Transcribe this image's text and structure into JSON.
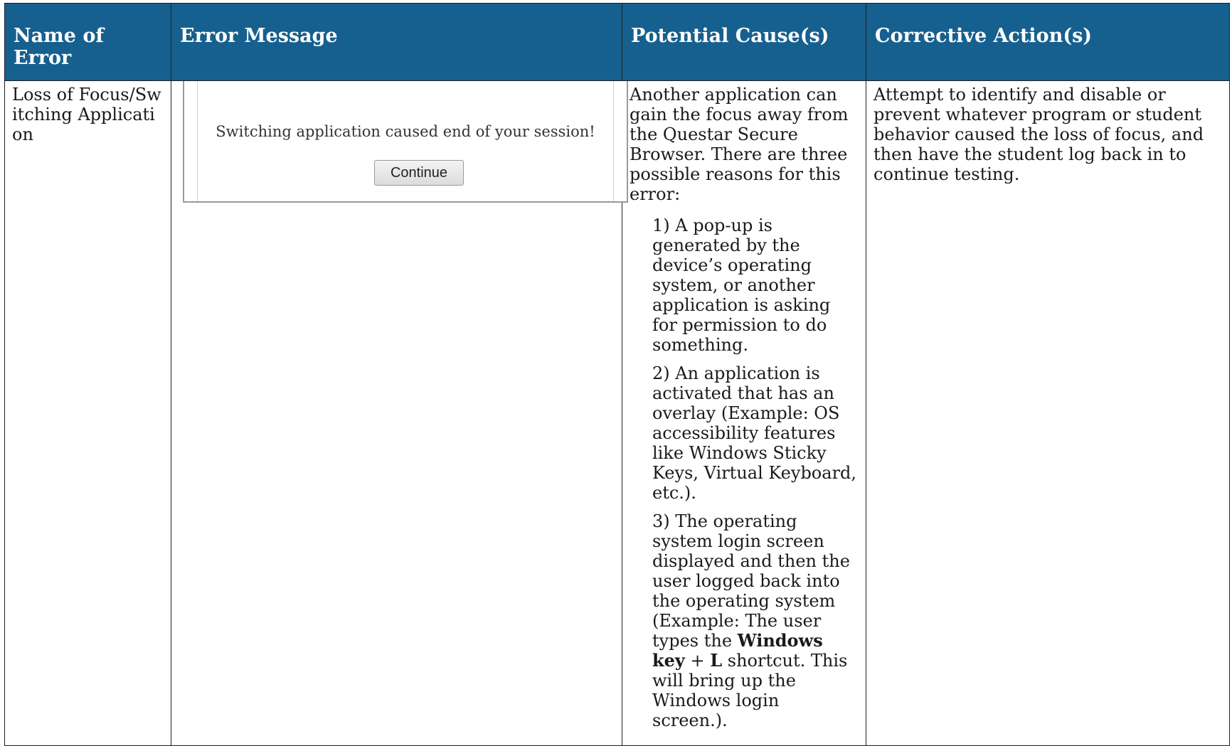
{
  "headers": {
    "name": "Name of Error",
    "message": "Error Message",
    "cause": "Potential Cause(s)",
    "action": "Corrective Action(s)"
  },
  "row": {
    "name": "Loss of Focus/Switching Application",
    "message_screenshot": {
      "text": "Switching application caused end of your session!",
      "button_label": "Continue"
    },
    "cause_intro": "Another application can gain the focus away from the Questar Secure Browser. There are three possible reasons for this error:",
    "cause_1": "1) A pop-up is generated by the device’s operating system, or another application is asking for permission to do something.",
    "cause_2": "2) An application is activated that has an overlay (Example: OS accessibility features like Windows Sticky Keys, Virtual Keyboard, etc.).",
    "cause_3_pre": "3) The operating system login screen displayed and then the user logged back into the operating system (Example: The user types the",
    "cause_3_key": "Windows key",
    "cause_3_plus": "+",
    "cause_3_letter": "L",
    "cause_3_post": "shortcut. This will bring up the Windows login screen.).",
    "action": "Attempt to identify and disable or prevent whatever program or student behavior caused the loss of focus, and then have the student log back in to continue testing."
  }
}
